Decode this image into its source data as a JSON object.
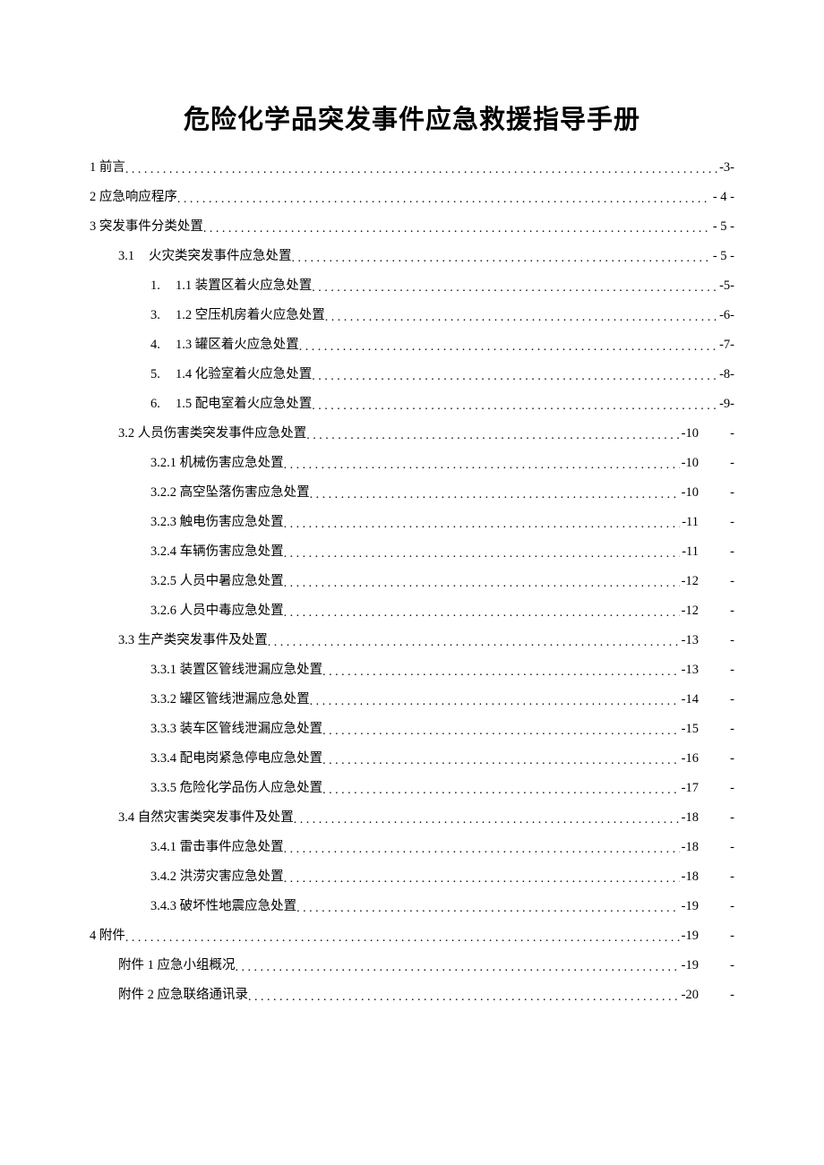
{
  "title": "危险化学品突发事件应急救援指导手册",
  "toc": [
    {
      "indent": 0,
      "num": "",
      "label": "1 前言",
      "page": "-3-",
      "trail": ""
    },
    {
      "indent": 0,
      "num": "",
      "label": "2 应急响应程序",
      "page": "- 4 -",
      "trail": ""
    },
    {
      "indent": 0,
      "num": "",
      "label": "3 突发事件分类处置",
      "page": "- 5 -",
      "trail": ""
    },
    {
      "indent": 1,
      "num": "3.1",
      "label": "火灾类突发事件应急处置",
      "page": "- 5 -",
      "trail": "",
      "numwide": true
    },
    {
      "indent": 2,
      "num": "1.",
      "label": "1.1 装置区着火应急处置",
      "page": "-5-",
      "trail": ""
    },
    {
      "indent": 2,
      "num": "3.",
      "label": "1.2 空压机房着火应急处置",
      "page": "-6-",
      "trail": ""
    },
    {
      "indent": 2,
      "num": "4.",
      "label": "1.3 罐区着火应急处置",
      "page": "-7-",
      "trail": ""
    },
    {
      "indent": 2,
      "num": "5.",
      "label": "1.4 化验室着火应急处置",
      "page": "-8-",
      "trail": ""
    },
    {
      "indent": 2,
      "num": "6.",
      "label": "1.5 配电室着火应急处置",
      "page": "-9-",
      "trail": ""
    },
    {
      "indent": 1,
      "num": "",
      "label": "3.2 人员伤害类突发事件应急处置",
      "page": "-10",
      "trail": "-"
    },
    {
      "indent": 2,
      "num": "",
      "label": "3.2.1 机械伤害应急处置",
      "page": "-10",
      "trail": "-"
    },
    {
      "indent": 2,
      "num": "",
      "label": "3.2.2 高空坠落伤害应急处置",
      "page": "-10",
      "trail": "-"
    },
    {
      "indent": 2,
      "num": "",
      "label": "3.2.3 触电伤害应急处置",
      "page": "-11",
      "trail": "-"
    },
    {
      "indent": 2,
      "num": "",
      "label": "3.2.4 车辆伤害应急处置",
      "page": "-11",
      "trail": "-"
    },
    {
      "indent": 2,
      "num": "",
      "label": "3.2.5 人员中暑应急处置",
      "page": "-12",
      "trail": "-"
    },
    {
      "indent": 2,
      "num": "",
      "label": "3.2.6 人员中毒应急处置",
      "page": "-12",
      "trail": "-"
    },
    {
      "indent": 1,
      "num": "",
      "label": "3.3 生产类突发事件及处置",
      "page": "-13",
      "trail": "-"
    },
    {
      "indent": 2,
      "num": "",
      "label": "3.3.1 装置区管线泄漏应急处置",
      "page": "-13",
      "trail": "-"
    },
    {
      "indent": 2,
      "num": "",
      "label": "3.3.2 罐区管线泄漏应急处置",
      "page": "-14",
      "trail": "-"
    },
    {
      "indent": 2,
      "num": "",
      "label": "3.3.3 装车区管线泄漏应急处置",
      "page": "-15",
      "trail": "-"
    },
    {
      "indent": 2,
      "num": "",
      "label": "3.3.4 配电岗紧急停电应急处置",
      "page": "-16",
      "trail": "-"
    },
    {
      "indent": 2,
      "num": "",
      "label": "3.3.5 危险化学品伤人应急处置",
      "page": "-17",
      "trail": "-"
    },
    {
      "indent": 1,
      "num": "",
      "label": "3.4 自然灾害类突发事件及处置",
      "page": "-18",
      "trail": "-"
    },
    {
      "indent": 2,
      "num": "",
      "label": "3.4.1 雷击事件应急处置",
      "page": "-18",
      "trail": "-"
    },
    {
      "indent": 2,
      "num": "",
      "label": "3.4.2 洪涝灾害应急处置",
      "page": "-18",
      "trail": "-"
    },
    {
      "indent": 2,
      "num": "",
      "label": "3.4.3 破坏性地震应急处置",
      "page": "-19",
      "trail": "-"
    },
    {
      "indent": 0,
      "num": "",
      "label": "4 附件",
      "page": "-19",
      "trail": "-"
    },
    {
      "indent": 1,
      "num": "",
      "label": "附件 1 应急小组概况",
      "page": "-19",
      "trail": "-"
    },
    {
      "indent": 1,
      "num": "",
      "label": "附件 2 应急联络通讯录",
      "page": "-20",
      "trail": "-"
    }
  ]
}
